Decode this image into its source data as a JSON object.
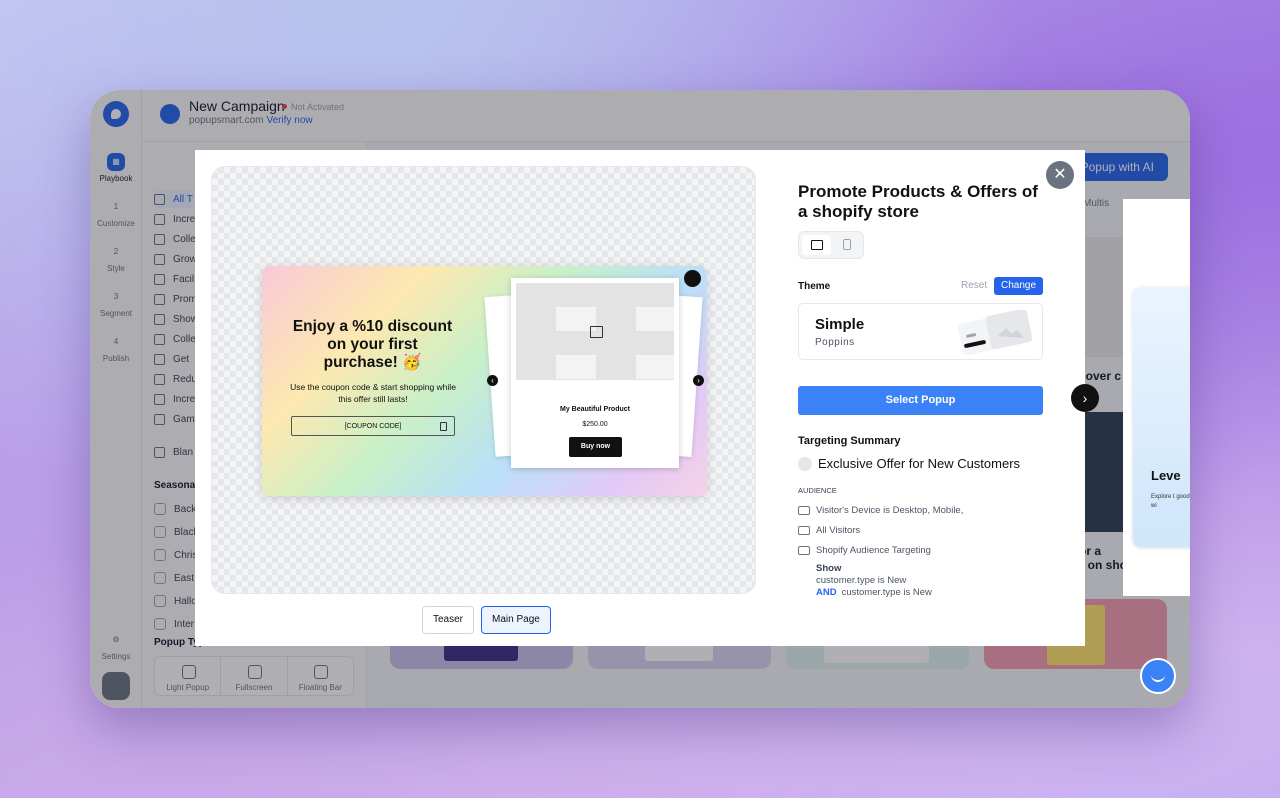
{
  "app": {
    "campaign_title": "New Campaign",
    "status": "Not Activated",
    "domain": "popupsmart.com",
    "verify_link": "Verify now"
  },
  "rail": {
    "steps": [
      {
        "num": "",
        "label": "Playbook"
      },
      {
        "num": "1",
        "label": "Customize"
      },
      {
        "num": "2",
        "label": "Style"
      },
      {
        "num": "3",
        "label": "Segment"
      },
      {
        "num": "4",
        "label": "Publish"
      }
    ],
    "settings_label": "Settings"
  },
  "sidebar": {
    "items": [
      "All T",
      "Incre",
      "Colle",
      "Grow",
      "Facil",
      "Prom",
      "Show",
      "Colle",
      "Get",
      "Redu",
      "Incre",
      "Gam"
    ],
    "blank": "Blan",
    "seasonal_heading": "Seasonal",
    "seasonal_items": [
      "Back",
      "Black",
      "Chris",
      "East",
      "Hallo",
      "Inter"
    ],
    "popup_type_heading": "Popup Type",
    "popup_types": [
      "Light Popup",
      "Fullscreen",
      "Floating Bar"
    ]
  },
  "main": {
    "ai_button": "Popup with AI",
    "multistep_label": "Multis",
    "bg_text_1": "cover c",
    "bg_text_2": "or a",
    "bg_text_3": "ple on shopify"
  },
  "modal": {
    "title": "Promote Products & Offers of a shopify store",
    "preview": {
      "headline": "Enjoy a %10 discount on your first purchase! 🥳",
      "body": "Use the coupon code & start shopping while this offer still lasts!",
      "coupon": "[COUPON CODE]",
      "product_name": "My Beautiful Product",
      "product_price": "$250.00",
      "buy_label": "Buy now"
    },
    "view_tabs": [
      "Teaser",
      "Main Page"
    ],
    "active_tab": "Main Page",
    "theme": {
      "label": "Theme",
      "reset": "Reset",
      "change": "Change",
      "name": "Simple",
      "font": "Poppins"
    },
    "select_button": "Select Popup",
    "targeting": {
      "heading": "Targeting Summary",
      "segment": "Exclusive Offer for New Customers",
      "audience_label": "AUDIENCE",
      "audience_items": [
        "Visitor's Device is Desktop, Mobile,",
        "All Visitors",
        "Shopify Audience Targeting"
      ],
      "show_label": "Show",
      "condition_1": "customer.type is New",
      "and_label": "AND",
      "condition_2": "customer.type is New"
    }
  },
  "peek": {
    "heading": "Leve",
    "text": "Explore t good wi"
  },
  "colors": {
    "accent": "#2563eb",
    "select_button": "#3b82f6",
    "status_dot": "#ef4444"
  },
  "icons": [
    "close-icon",
    "chevron-right-icon",
    "laptop-icon",
    "mobile-icon",
    "copy-icon",
    "image-icon",
    "chat-icon",
    "briefcase-icon"
  ]
}
